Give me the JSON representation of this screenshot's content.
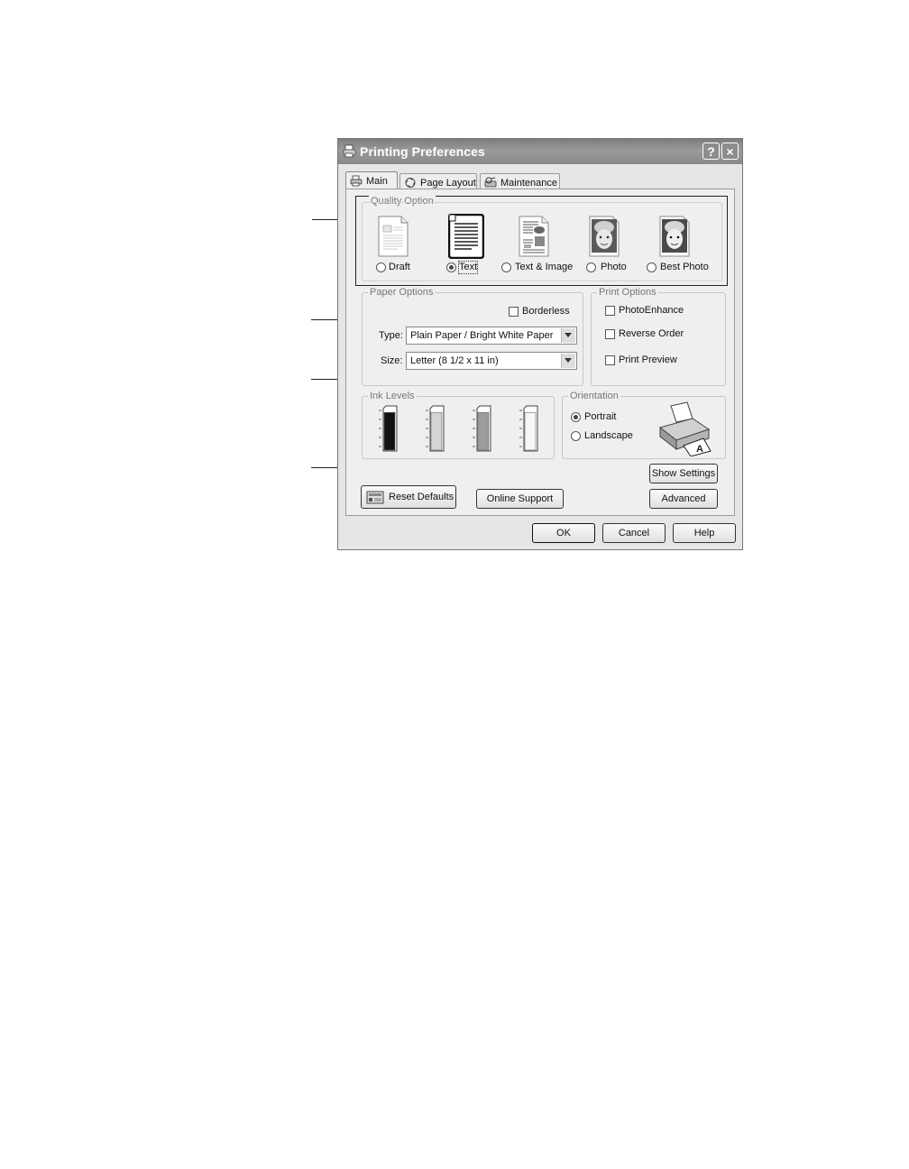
{
  "dialog": {
    "title": "Printing Preferences",
    "help_button": "?",
    "close_button": "×"
  },
  "tabs": [
    {
      "label": "Main",
      "icon": "printer-icon",
      "active": true
    },
    {
      "label": "Page Layout",
      "icon": "page-layout-icon",
      "active": false
    },
    {
      "label": "Maintenance",
      "icon": "maintenance-icon",
      "active": false
    }
  ],
  "quality": {
    "group_label": "Quality Option",
    "options": [
      {
        "label": "Draft",
        "icon": "draft-page-icon",
        "selected": false
      },
      {
        "label": "Text",
        "icon": "text-page-icon",
        "selected": true
      },
      {
        "label": "Text & Image",
        "icon": "text-image-page-icon",
        "selected": false
      },
      {
        "label": "Photo",
        "icon": "photo-page-icon",
        "selected": false
      },
      {
        "label": "Best Photo",
        "icon": "best-photo-page-icon",
        "selected": false
      }
    ]
  },
  "paper": {
    "group_label": "Paper Options",
    "borderless_label": "Borderless",
    "borderless_checked": false,
    "type_label": "Type:",
    "type_value": "Plain Paper / Bright White Paper",
    "size_label": "Size:",
    "size_value": "Letter (8 1/2 x 11 in)"
  },
  "print_options": {
    "group_label": "Print Options",
    "items": [
      {
        "label": "PhotoEnhance",
        "checked": false
      },
      {
        "label": "Reverse Order",
        "checked": false
      },
      {
        "label": "Print Preview",
        "checked": false
      }
    ]
  },
  "ink": {
    "group_label": "Ink Levels",
    "cartridges": [
      {
        "level": 0.95,
        "color": "#111111"
      },
      {
        "level": 0.95,
        "color": "#d4d4d4"
      },
      {
        "level": 0.95,
        "color": "#9c9c9c"
      },
      {
        "level": 0.95,
        "color": "#f6f6f6"
      }
    ]
  },
  "orientation": {
    "group_label": "Orientation",
    "portrait_label": "Portrait",
    "landscape_label": "Landscape",
    "selected": "Portrait"
  },
  "buttons": {
    "show_settings": "Show Settings",
    "advanced": "Advanced",
    "reset_defaults": "Reset Defaults",
    "online_support": "Online Support",
    "ok": "OK",
    "cancel": "Cancel",
    "help": "Help"
  }
}
